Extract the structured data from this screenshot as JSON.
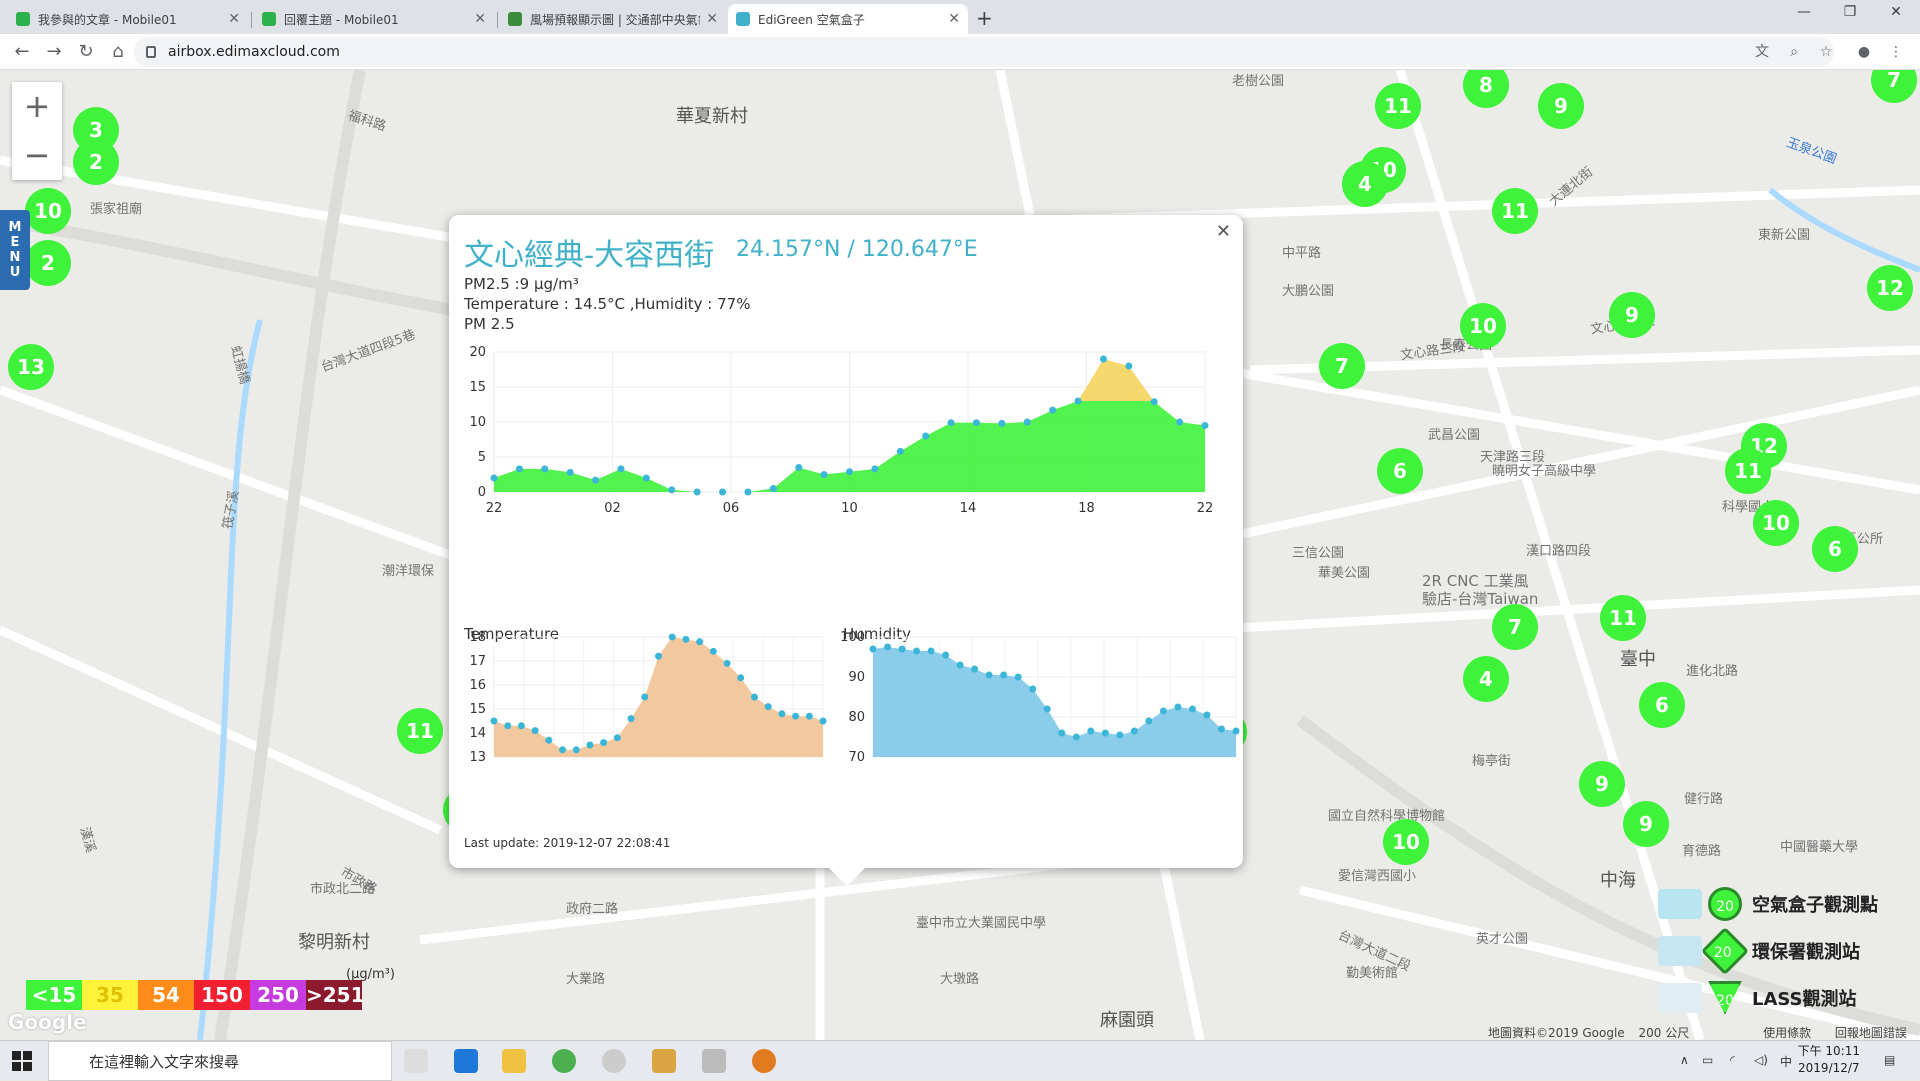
{
  "browser": {
    "tabs": [
      {
        "label": "我參與的文章 - Mobile01",
        "icon_color": "#2bb24c"
      },
      {
        "label": "回覆主題 - Mobile01",
        "icon_color": "#2bb24c"
      },
      {
        "label": "風場預報顯示圖 | 交通部中央氣象",
        "icon_color": "#3a8c3a"
      },
      {
        "label": "EdiGreen 空氣盒子",
        "icon_color": "#41b1c9",
        "active": true
      }
    ],
    "url": "airbox.edimaxcloud.com",
    "new_tab_icon": "plus-icon"
  },
  "map": {
    "labels": [
      {
        "text": "華夏新村",
        "big": true
      },
      {
        "text": "老樹公園"
      },
      {
        "text": "張家祖廟"
      },
      {
        "text": "虹揚橋"
      },
      {
        "text": "福科路"
      },
      {
        "text": "台灣大道四段5巷"
      },
      {
        "text": "中平路"
      },
      {
        "text": "大鵬公園"
      },
      {
        "text": "長春公園"
      },
      {
        "text": "文心路四段"
      },
      {
        "text": "文心路三段"
      },
      {
        "text": "東新公園"
      },
      {
        "text": "武昌公園"
      },
      {
        "text": "曉明女子高級中學"
      },
      {
        "text": "三信公園"
      },
      {
        "text": "華美公園"
      },
      {
        "text": "2R CNC 工業風"
      },
      {
        "text": "驗店-台灣Taiwan"
      },
      {
        "text": "臺中",
        "big": true
      },
      {
        "text": "國立自然科學博物館"
      },
      {
        "text": "黎明新村",
        "big": true
      },
      {
        "text": "市政路"
      },
      {
        "text": "大業路"
      },
      {
        "text": "臺中市立大業國民中學"
      },
      {
        "text": "大墩路"
      },
      {
        "text": "愛信灣西國小"
      },
      {
        "text": "台灣大道二段"
      },
      {
        "text": "英才公園"
      },
      {
        "text": "勤美術館"
      },
      {
        "text": "市政北二路"
      },
      {
        "text": "政府二路"
      },
      {
        "text": "麻園頭",
        "big": true
      },
      {
        "text": "中海",
        "big": true
      },
      {
        "text": "漢口路四段"
      },
      {
        "text": "進化北路"
      },
      {
        "text": "健行路"
      },
      {
        "text": "育德路"
      },
      {
        "text": "中國醫藥大學"
      },
      {
        "text": "漢溪"
      },
      {
        "text": "筏子溪"
      },
      {
        "text": "潮洋環保"
      },
      {
        "text": "梅亭街"
      },
      {
        "text": "天津路三段"
      },
      {
        "text": "大連北街"
      },
      {
        "text": "科學國小"
      },
      {
        "text": "北區區公所"
      },
      {
        "text": "玉泉公園"
      }
    ],
    "markers": [
      {
        "v": "3"
      },
      {
        "v": "2"
      },
      {
        "v": "10"
      },
      {
        "v": "2"
      },
      {
        "v": "13"
      },
      {
        "v": "11"
      },
      {
        "v": "8"
      },
      {
        "v": "9"
      },
      {
        "v": "7"
      },
      {
        "v": "10"
      },
      {
        "v": "4"
      },
      {
        "v": "11"
      },
      {
        "v": "12"
      },
      {
        "v": "9"
      },
      {
        "v": "10"
      },
      {
        "v": "7"
      },
      {
        "v": "6"
      },
      {
        "v": "12"
      },
      {
        "v": "11"
      },
      {
        "v": "10"
      },
      {
        "v": "6"
      },
      {
        "v": "7"
      },
      {
        "v": "11"
      },
      {
        "v": "4"
      },
      {
        "v": "6"
      },
      {
        "v": "5"
      },
      {
        "v": "11"
      },
      {
        "v": "32",
        "yellow": true
      },
      {
        "v": "7"
      },
      {
        "v": "0"
      },
      {
        "v": "8"
      },
      {
        "v": "9"
      },
      {
        "v": "9"
      },
      {
        "v": "9"
      },
      {
        "v": "6"
      },
      {
        "v": "11"
      },
      {
        "v": "9"
      },
      {
        "v": "9"
      },
      {
        "v": "10"
      },
      {
        "v": "9"
      }
    ],
    "zoom_in": "+",
    "zoom_out": "−",
    "menu_label": [
      "M",
      "E",
      "N",
      "U"
    ],
    "aqi_legend": [
      {
        "label": "<15",
        "color": "#3ff23a"
      },
      {
        "label": "35",
        "color": "#fff23a"
      },
      {
        "label": "54",
        "color": "#ff8c1a"
      },
      {
        "label": "150",
        "color": "#f11f2f"
      },
      {
        "label": "250",
        "color": "#c63adf"
      },
      {
        "label": ">251",
        "color": "#8d1a2c"
      }
    ],
    "aqi_unit": "(μg/m³)",
    "google_logo": "Google",
    "station_types": [
      {
        "label": "空氣盒子觀測點",
        "value": "20",
        "icon_name": "airbox-icon"
      },
      {
        "label": "環保署觀測站",
        "value": "20",
        "icon_name": "epa-station-icon"
      },
      {
        "label": "LASS觀測站",
        "value": "20",
        "icon_name": "lass-station-icon"
      }
    ],
    "footer": {
      "attribution": "地圖資料©2019 Google",
      "scale": "200 公尺",
      "terms": "使用條款",
      "report": "回報地圖錯誤"
    }
  },
  "popup": {
    "title": "文心經典-大容西街",
    "coords": "24.157°N / 120.647°E",
    "pm25_line": "PM2.5 :9 μg/m³",
    "temp_line": "Temperature : 14.5°C ,Humidity : 77%",
    "pm_label": "PM 2.5",
    "temp_label": "Temperature",
    "hum_label": "Humidity",
    "last_update": "Last update: 2019-12-07 22:08:41",
    "close_icon": "close-icon"
  },
  "chart_data": [
    {
      "type": "area",
      "title": "PM 2.5",
      "x_ticks": [
        "22",
        "02",
        "06",
        "10",
        "14",
        "18",
        "22"
      ],
      "ylim": [
        0,
        20
      ],
      "y_ticks": [
        0,
        5,
        10,
        15,
        20
      ],
      "values": [
        2,
        3.3,
        3.3,
        2.8,
        1.7,
        3.3,
        2,
        0.3,
        0,
        0,
        0,
        0.5,
        3.5,
        2.5,
        2.9,
        3.3,
        5.8,
        8,
        9.9,
        9.9,
        9.8,
        10,
        11.7,
        13,
        19,
        18,
        12.9,
        10,
        9.5
      ],
      "colors": {
        "good": "#3ff23a",
        "moderate": "#f4d35e"
      },
      "threshold": 13
    },
    {
      "type": "area",
      "title": "Temperature",
      "ylim": [
        13,
        18
      ],
      "y_ticks": [
        13,
        14,
        15,
        16,
        17,
        18
      ],
      "values": [
        14.5,
        14.3,
        14.3,
        14.1,
        13.7,
        13.3,
        13.3,
        13.5,
        13.6,
        13.8,
        14.6,
        15.5,
        17.2,
        18,
        17.9,
        17.8,
        17.4,
        16.9,
        16.3,
        15.5,
        15.1,
        14.8,
        14.7,
        14.7,
        14.5
      ],
      "color": "#f2c294"
    },
    {
      "type": "area",
      "title": "Humidity",
      "ylim": [
        70,
        100
      ],
      "y_ticks": [
        70,
        80,
        90,
        100
      ],
      "values": [
        97,
        97.5,
        97,
        96.5,
        96.5,
        95.5,
        93,
        92,
        90.5,
        90.5,
        90,
        87,
        82,
        76,
        75,
        76.5,
        76,
        75.5,
        76.5,
        79,
        81.5,
        82.5,
        82,
        80.5,
        77,
        76.5
      ],
      "color": "#7ec6e8"
    }
  ],
  "taskbar": {
    "search_placeholder": "在這裡輸入文字來搜尋",
    "time": "下午 10:11",
    "date": "2019/12/7",
    "ime": "中"
  }
}
